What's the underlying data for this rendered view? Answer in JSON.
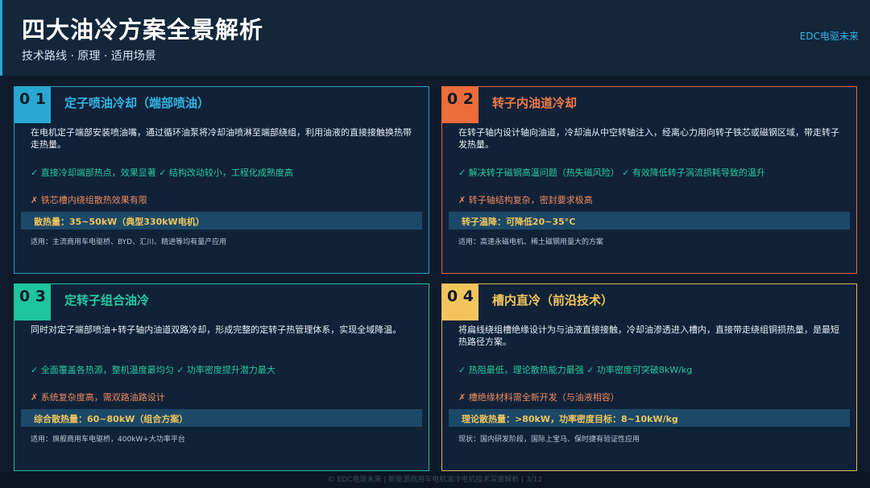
{
  "header": {
    "title": "四大油冷方案全景解析",
    "subtitle": "技术路线 · 原理 · 适用场景",
    "brand": "EDC电驱未来"
  },
  "cards": [
    {
      "number": "0 1",
      "title": "定子喷油冷却（端部喷油）",
      "description": "在电机定子端部安装喷油嘴，通过循环油泵将冷却油喷淋至端部绕组，利用油液的直接接触换热带走热量。",
      "pros": "✓ 直接冷却端部热点，效果显著 ✓ 结构改动较小，工程化成熟度高",
      "cons": "✗ 铁芯槽内绕组散热效果有限",
      "metric": "散热量：35~50kW（典型330kW电机）",
      "application": "适用：主流商用车电驱桥、BYD、汇川、精进等均有量产应用",
      "accent": "#2aa7d3"
    },
    {
      "number": "0 2",
      "title": "转子内油道冷却",
      "description": "在转子轴内设计轴向油道，冷却油从中空转轴注入，经离心力用向转子铁芯或磁钢区域，带走转子发热量。",
      "pros": "✓ 解决转子磁钢高温问题（热失磁风险） ✓ 有效降低转子涡流损耗导致的温升",
      "cons": "✗ 转子轴结构复杂，密封要求极高",
      "metric": "转子温降：可降低20~35°C",
      "application": "适用：高速永磁电机、稀土磁钢用量大的方案",
      "accent": "#ee6c3a"
    },
    {
      "number": "0 3",
      "title": "定转子组合油冷",
      "description": "同时对定子端部喷油+转子轴内油道双路冷却，形成完整的定转子热管理体系，实现全域降温。",
      "pros": "✓ 全面覆盖各热源，整机温度最均匀 ✓ 功率密度提升潜力最大",
      "cons": "✗ 系统复杂度高，需双路油路设计",
      "metric": "综合散热量：60~80kW（组合方案）",
      "application": "适用：旗舰商用车电驱桥，400kW+大功率平台",
      "accent": "#1fc59d"
    },
    {
      "number": "0 4",
      "title": "槽内直冷（前沿技术）",
      "description": "将扁线绕组槽绝缘设计为与油液直接接触，冷却油渗透进入槽内，直接带走绕组铜损热量，是最短热路径方案。",
      "pros": "✓ 热阻最低，理论散热能力最强 ✓ 功率密度可突破8kW/kg",
      "cons": "✗ 槽绝缘材料需全新开发（与油液相容）",
      "metric": "理论散热量：>80kW，功率密度目标：8~10kW/kg",
      "application": "现状：国内研发阶段，国际上宝马、保时捷有验证性应用",
      "accent": "#f2c55c"
    }
  ],
  "footer": {
    "text": "© EDC电驱未来 | 新能源商用车电机油冷电机技术深度解析 | 3/12"
  }
}
